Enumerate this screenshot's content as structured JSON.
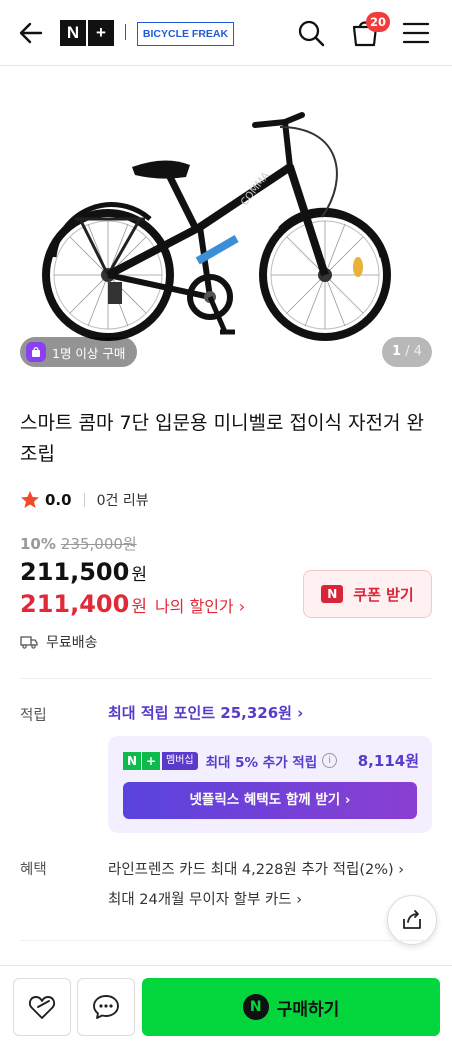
{
  "header": {
    "logo_n": "N",
    "logo_plus": "+",
    "brand": "BICYCLE FREAK",
    "cart_count": "20"
  },
  "gallery": {
    "buyer_badge": "1명 이상 구매",
    "page_current": "1",
    "page_total": "/ 4",
    "frame_text": "COMMA"
  },
  "product": {
    "title": "스마트 콤마 7단 입문용 미니벨로 접이식 자전거 완조립",
    "rating": "0.0",
    "reviews": "0건 리뷰",
    "discount_rate": "10%",
    "original_price": "235,000원",
    "price": "211,500",
    "price_unit": "원",
    "my_price": "211,400",
    "my_price_unit": "원",
    "my_price_label": "나의 할인가 ›",
    "coupon_mark": "N",
    "coupon_label": "쿠폰 받기",
    "shipping": "무료배송"
  },
  "points": {
    "label": "적립",
    "max_points": "최대 적립 포인트 25,326원 ›",
    "membership_tag": "멤버십",
    "membership_text": "최대 5% 추가 적립",
    "membership_amount": "8,114원",
    "netflix_button": "넷플릭스 혜택도 함께 받기 ›"
  },
  "benefits": {
    "label": "혜택",
    "card_benefit": "라인프렌즈 카드 최대 4,228원 추가 적립(2%) ›",
    "installment": "최대 24개월 무이자 할부 카드 ›"
  },
  "bottom": {
    "buy_mark": "N",
    "buy_label": "구매하기"
  },
  "colors": {
    "accent_purple": "#5a3ac9",
    "discount_red": "#e02a3a",
    "naver_green": "#03d53d"
  }
}
